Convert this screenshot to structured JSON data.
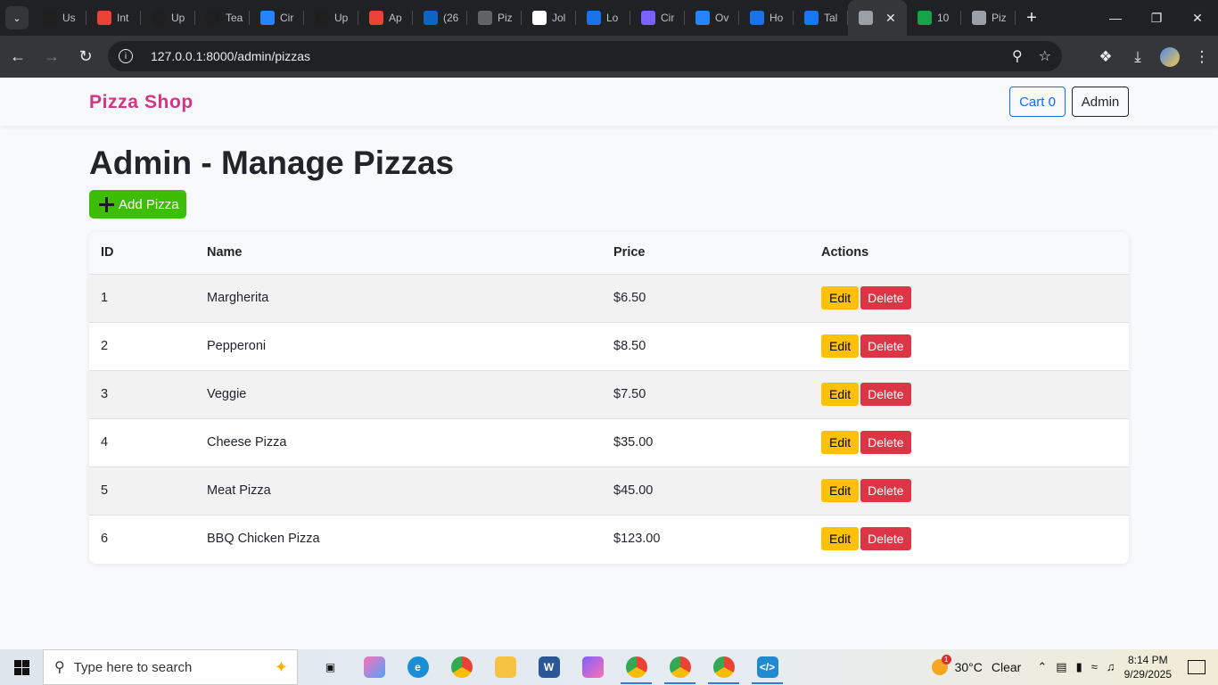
{
  "browser": {
    "tabs": [
      {
        "label": "Us",
        "icon": "upwork-icon",
        "color": "#1f1f1f"
      },
      {
        "label": "Int",
        "icon": "gmail-icon",
        "color": "#ea4335"
      },
      {
        "label": "Up",
        "icon": "upwork-icon",
        "color": "#1f1f1f"
      },
      {
        "label": "Tea",
        "icon": "upwork-icon",
        "color": "#1f1f1f"
      },
      {
        "label": "Cir",
        "icon": "jira-icon",
        "color": "#2684ff"
      },
      {
        "label": "Up",
        "icon": "upwork-icon",
        "color": "#1f1f1f"
      },
      {
        "label": "Ap",
        "icon": "gmail-icon",
        "color": "#ea4335"
      },
      {
        "label": "(26",
        "icon": "linkedin-icon",
        "color": "#0a66c2"
      },
      {
        "label": "Piz",
        "icon": "chatgpt-icon",
        "color": "#5f6368"
      },
      {
        "label": "Jol",
        "icon": "info-icon",
        "color": "#ffffff"
      },
      {
        "label": "Lo",
        "icon": "refresh-icon",
        "color": "#1a73e8"
      },
      {
        "label": "Cir",
        "icon": "circle-dots-icon",
        "color": "#7b61ff"
      },
      {
        "label": "Ov",
        "icon": "bitbucket-icon",
        "color": "#2684ff"
      },
      {
        "label": "Ho",
        "icon": "loop-icon",
        "color": "#1a73e8"
      },
      {
        "label": "Tal",
        "icon": "facebook-icon",
        "color": "#1877f2"
      },
      {
        "label": "",
        "icon": "globe-icon",
        "color": "#9aa0a6",
        "active": true
      },
      {
        "label": "10",
        "icon": "e-icon",
        "color": "#16a34a"
      },
      {
        "label": "Piz",
        "icon": "globe-icon",
        "color": "#9aa0a6"
      }
    ],
    "url": "127.0.0.1:8000/admin/pizzas"
  },
  "navbar": {
    "brand": "Pizza Shop",
    "cart_label": "Cart 0",
    "admin_label": "Admin"
  },
  "main": {
    "title": "Admin - Manage Pizzas",
    "add_button": "Add Pizza"
  },
  "table": {
    "headers": [
      "ID",
      "Name",
      "Price",
      "Actions"
    ],
    "rows": [
      {
        "id": "1",
        "name": "Margherita",
        "price": "$6.50"
      },
      {
        "id": "2",
        "name": "Pepperoni",
        "price": "$8.50"
      },
      {
        "id": "3",
        "name": "Veggie",
        "price": "$7.50"
      },
      {
        "id": "4",
        "name": "Cheese Pizza",
        "price": "$35.00"
      },
      {
        "id": "5",
        "name": "Meat Pizza",
        "price": "$45.00"
      },
      {
        "id": "6",
        "name": "BBQ Chicken Pizza",
        "price": "$123.00"
      }
    ],
    "edit_label": "Edit",
    "delete_label": "Delete"
  },
  "taskbar": {
    "search_placeholder": "Type here to search",
    "weather_temp": "30°C",
    "weather_text": "Clear",
    "weather_badge": "1",
    "time": "8:14 PM",
    "date": "9/29/2025"
  },
  "colors": {
    "brand": "#d63384",
    "add_button": "#3dbd06",
    "edit": "#ffc107",
    "delete": "#dc3545",
    "cart_outline": "#0d6efd"
  }
}
